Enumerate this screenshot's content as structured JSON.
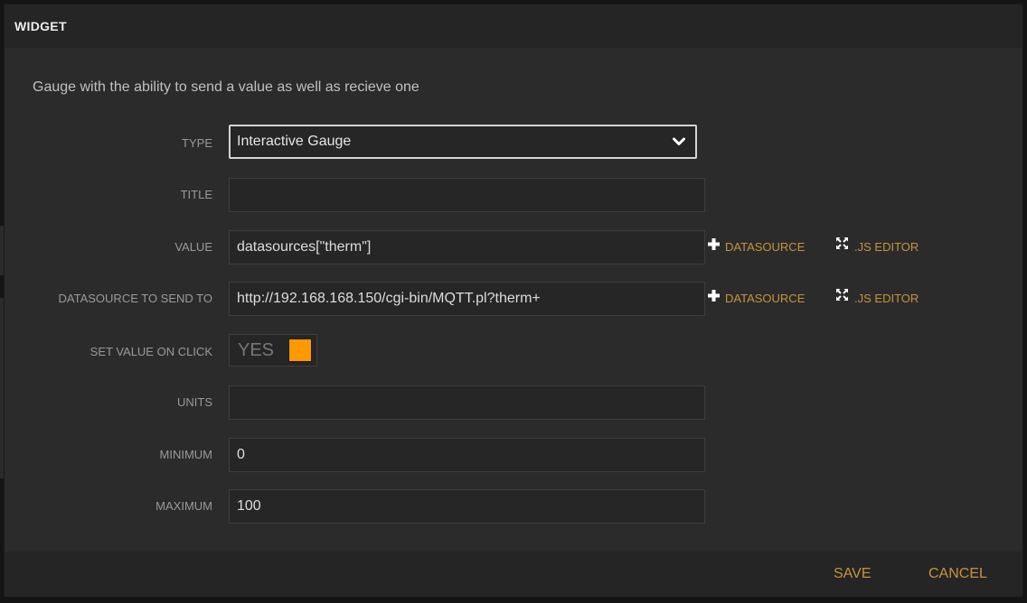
{
  "modal": {
    "title": "WIDGET",
    "description": "Gauge with the ability to send a value as well as recieve one"
  },
  "fields": {
    "type": {
      "label": "TYPE",
      "value": "Interactive Gauge"
    },
    "title": {
      "label": "TITLE",
      "value": ""
    },
    "value": {
      "label": "VALUE",
      "value": "datasources[\"therm\"]"
    },
    "datasource_to_send_to": {
      "label": "DATASOURCE TO SEND TO",
      "value": "http://192.168.168.150/cgi-bin/MQTT.pl?therm+"
    },
    "set_value_on_click": {
      "label": "SET VALUE ON CLICK",
      "state": "YES"
    },
    "units": {
      "label": "UNITS",
      "value": ""
    },
    "minimum": {
      "label": "MINIMUM",
      "value": "0"
    },
    "maximum": {
      "label": "MAXIMUM",
      "value": "100"
    }
  },
  "actions": {
    "datasource": "DATASOURCE",
    "js_editor": ".JS EDITOR"
  },
  "footer": {
    "save": "SAVE",
    "cancel": "CANCEL"
  },
  "colors": {
    "accent": "#c7933d",
    "toggle_on": "#ff9900",
    "background": "#2b2b2b"
  },
  "icons": {
    "plus": "plus-icon",
    "expand": "expand-icon",
    "chevron": "chevron-down-icon"
  }
}
